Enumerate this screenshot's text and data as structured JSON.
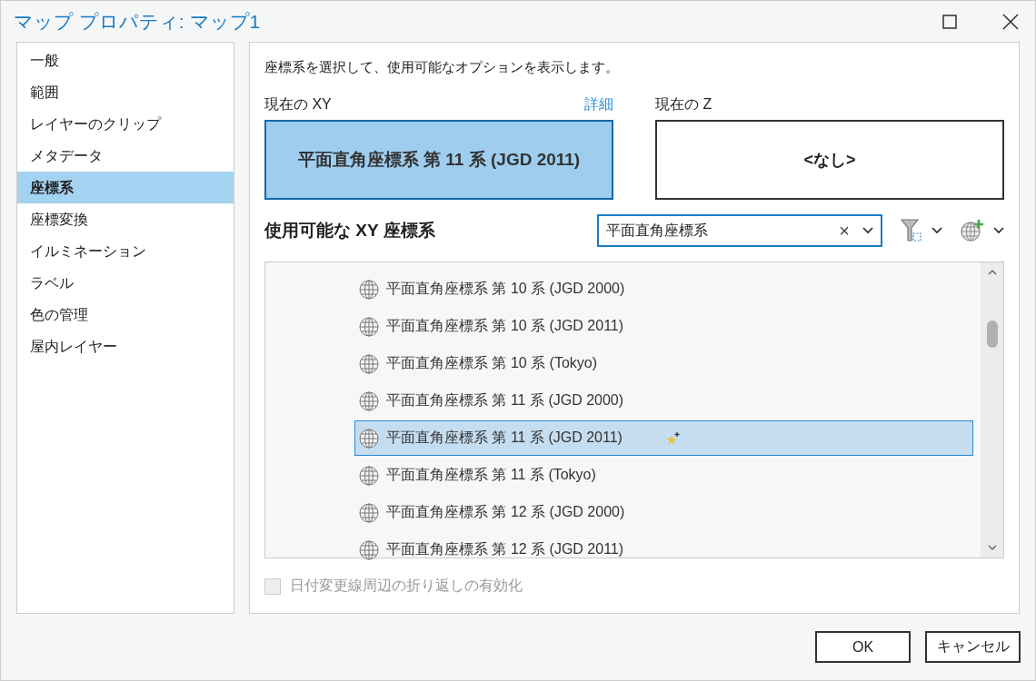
{
  "window": {
    "title": "マップ プロパティ: マップ1"
  },
  "sidebar": {
    "items": [
      {
        "label": "一般",
        "selected": false
      },
      {
        "label": "範囲",
        "selected": false
      },
      {
        "label": "レイヤーのクリップ",
        "selected": false
      },
      {
        "label": "メタデータ",
        "selected": false
      },
      {
        "label": "座標系",
        "selected": true
      },
      {
        "label": "座標変換",
        "selected": false
      },
      {
        "label": "イルミネーション",
        "selected": false
      },
      {
        "label": "ラベル",
        "selected": false
      },
      {
        "label": "色の管理",
        "selected": false
      },
      {
        "label": "屋内レイヤー",
        "selected": false
      }
    ]
  },
  "description": "座標系を選択して、使用可能なオプションを表示します。",
  "current_xy": {
    "label": "現在の XY",
    "details_link": "詳細",
    "value": "平面直角座標系 第 11 系 (JGD 2011)"
  },
  "current_z": {
    "label": "現在の Z",
    "value": "<なし>"
  },
  "available": {
    "label": "使用可能な XY 座標系",
    "search": {
      "value": "平面直角座標系",
      "clear": "×"
    },
    "rows": [
      {
        "label": "平面直角座標系 第 10 系 (JGD 2000)",
        "selected": false,
        "favorite": false
      },
      {
        "label": "平面直角座標系 第 10 系 (JGD 2011)",
        "selected": false,
        "favorite": false
      },
      {
        "label": "平面直角座標系 第 10 系 (Tokyo)",
        "selected": false,
        "favorite": false
      },
      {
        "label": "平面直角座標系 第 11 系 (JGD 2000)",
        "selected": false,
        "favorite": false
      },
      {
        "label": "平面直角座標系 第 11 系 (JGD 2011)",
        "selected": true,
        "favorite": true
      },
      {
        "label": "平面直角座標系 第 11 系 (Tokyo)",
        "selected": false,
        "favorite": false
      },
      {
        "label": "平面直角座標系 第 12 系 (JGD 2000)",
        "selected": false,
        "favorite": false
      },
      {
        "label": "平面直角座標系 第 12 系 (JGD 2011)",
        "selected": false,
        "favorite": false
      }
    ]
  },
  "wrap_checkbox": {
    "label": "日付変更線周辺の折り返しの有効化",
    "checked": false,
    "disabled": true
  },
  "buttons": [
    "OK",
    "キャンセル"
  ]
}
